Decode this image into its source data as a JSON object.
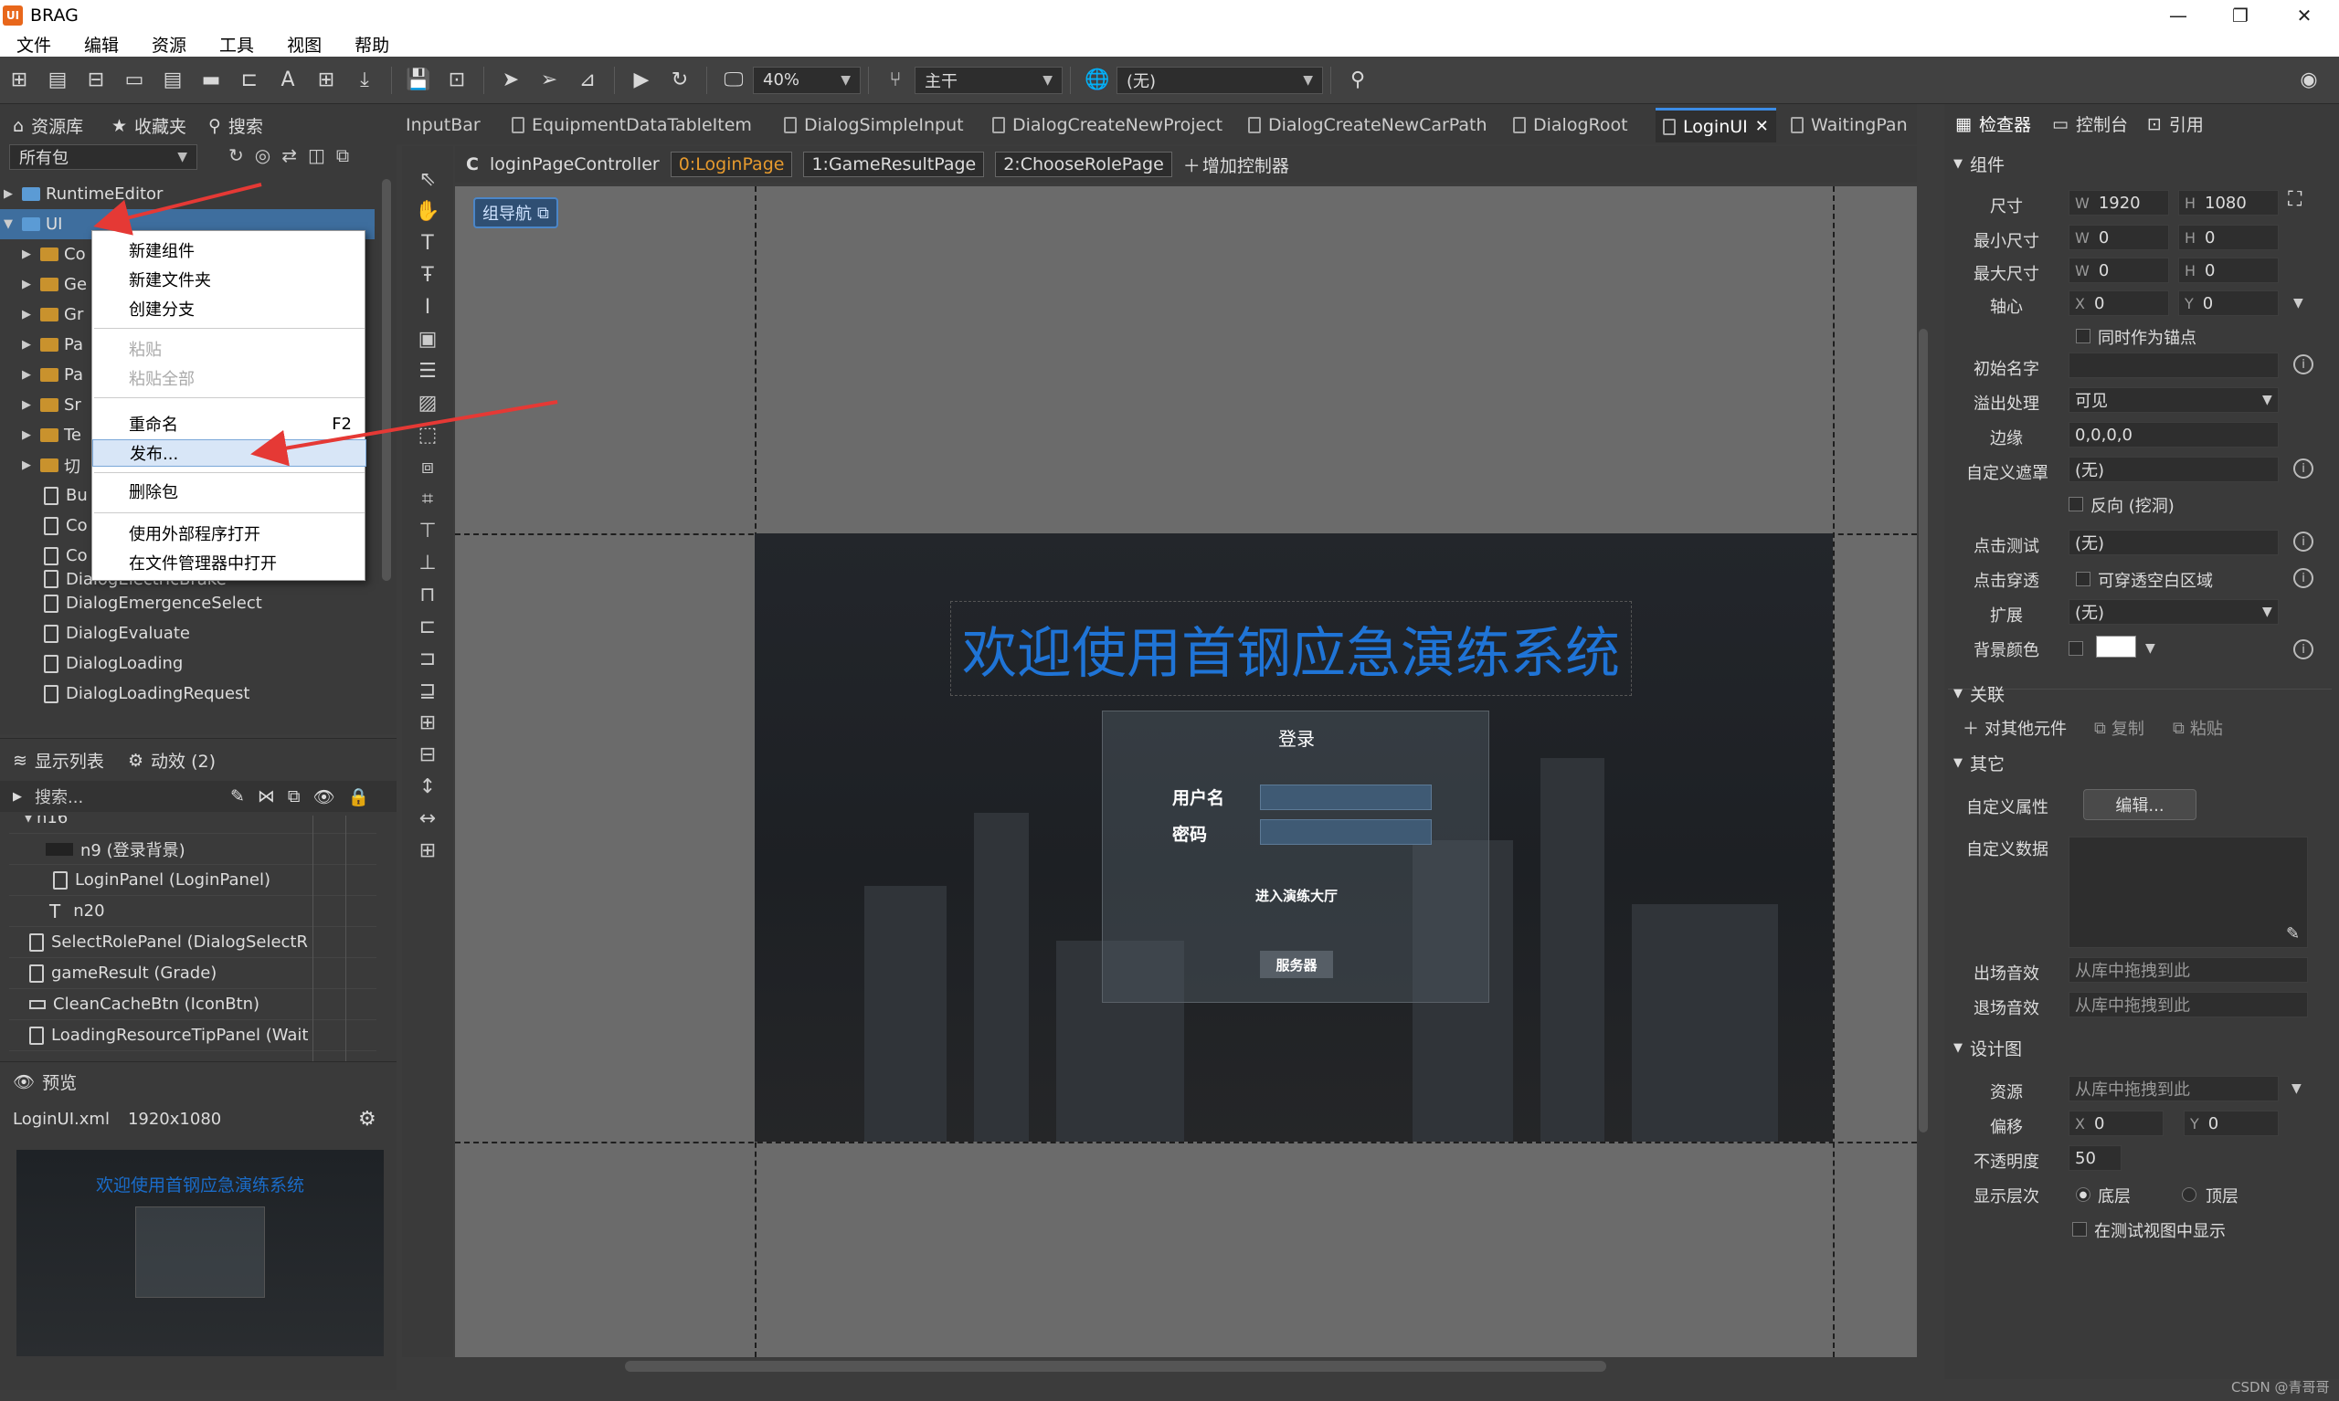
{
  "window": {
    "title": "BRAG",
    "logo": "UI"
  },
  "menu": [
    "文件",
    "编辑",
    "资源",
    "工具",
    "视图",
    "帮助"
  ],
  "toolbar": {
    "zoom": "40%",
    "branch": "主干",
    "language": "(无)"
  },
  "library": {
    "tabs": [
      "资源库",
      "收藏夹",
      "搜索"
    ],
    "package_filter": "所有包",
    "tree": [
      {
        "label": "RuntimeEditor",
        "type": "package"
      },
      {
        "label": "UI",
        "type": "package",
        "selected": true
      },
      {
        "label": "Co",
        "type": "folder"
      },
      {
        "label": "Ge",
        "type": "folder"
      },
      {
        "label": "Gr",
        "type": "folder"
      },
      {
        "label": "Pa",
        "type": "folder"
      },
      {
        "label": "Pa",
        "type": "folder"
      },
      {
        "label": "Sr",
        "type": "folder"
      },
      {
        "label": "Te",
        "type": "folder"
      },
      {
        "label": "切",
        "type": "folder"
      },
      {
        "label": "Bu",
        "type": "file"
      },
      {
        "label": "Co",
        "type": "file"
      },
      {
        "label": "Co",
        "type": "file"
      },
      {
        "label": "DialogElectricBrake",
        "type": "file"
      },
      {
        "label": "DialogEmergenceSelect",
        "type": "file"
      },
      {
        "label": "DialogEvaluate",
        "type": "file"
      },
      {
        "label": "DialogLoading",
        "type": "file"
      },
      {
        "label": "DialogLoadingRequest",
        "type": "file"
      }
    ]
  },
  "context_menu": {
    "items": [
      {
        "label": "新建组件"
      },
      {
        "label": "新建文件夹"
      },
      {
        "label": "创建分支"
      },
      {
        "label": "粘贴",
        "disabled": true
      },
      {
        "label": "粘贴全部",
        "disabled": true
      },
      {
        "label": "重命名",
        "shortcut": "F2"
      },
      {
        "label": "发布...",
        "highlighted": true
      },
      {
        "label": "删除包"
      },
      {
        "label": "使用外部程序打开"
      },
      {
        "label": "在文件管理器中打开"
      }
    ]
  },
  "hierarchy": {
    "tabs": [
      "显示列表",
      "动效 (2)"
    ],
    "search_placeholder": "搜索...",
    "rows": [
      "n16",
      "n9 (登录背景)",
      "LoginPanel (LoginPanel)",
      "n20",
      "SelectRolePanel (DialogSelectR",
      "gameResult (Grade)",
      "CleanCacheBtn (IconBtn)",
      "LoadingResourceTipPanel (Wait"
    ]
  },
  "preview": {
    "label": "预览",
    "file": "LoginUI.xml",
    "size": "1920x1080",
    "title": "欢迎使用首钢应急演练系统"
  },
  "doc_tabs": [
    "InputBar",
    "EquipmentDataTableItem",
    "DialogSimpleInput",
    "DialogCreateNewProject",
    "DialogCreateNewCarPath",
    "DialogRoot",
    "LoginUI",
    "WaitingPan"
  ],
  "active_doc": "LoginUI",
  "controller_bar": {
    "prefix": "C",
    "name": "loginPageController",
    "pages": [
      "0:LoginPage",
      "1:GameResultPage",
      "2:ChooseRolePage"
    ],
    "add": "增加控制器"
  },
  "canvas": {
    "nav_tag": "组导航",
    "headline": "欢迎使用首钢应急演练系统",
    "login_title": "登录",
    "username_label": "用户名",
    "password_label": "密码",
    "enter_button": "进入演练大厅",
    "server_button": "服务器"
  },
  "inspector": {
    "tabs": [
      "检查器",
      "控制台",
      "引用"
    ],
    "component_section": "组件",
    "size_label": "尺寸",
    "size_w": "1920",
    "size_h": "1080",
    "min_label": "最小尺寸",
    "min_w": "0",
    "min_h": "0",
    "max_label": "最大尺寸",
    "max_w": "0",
    "max_h": "0",
    "pivot_label": "轴心",
    "pivot_x": "0",
    "pivot_y": "0",
    "anchor_label": "同时作为锚点",
    "init_name_label": "初始名字",
    "init_name": "",
    "overflow_label": "溢出处理",
    "overflow": "可见",
    "margin_label": "边缘",
    "margin": "0,0,0,0",
    "mask_label": "自定义遮罩",
    "mask": "(无)",
    "reverse_label": "反向 (挖洞)",
    "hittest_label": "点击测试",
    "hittest": "(无)",
    "passthrough_label": "点击穿透",
    "passthrough_opt": "可穿透空白区域",
    "extend_label": "扩展",
    "extend": "(无)",
    "bgcolor_label": "背景颜色",
    "bgcolor": "#ffffff",
    "relation_section": "关联",
    "add_relation": "对其他元件",
    "copy": "复制",
    "paste": "粘贴",
    "other_section": "其它",
    "custom_prop_label": "自定义属性",
    "edit_button": "编辑...",
    "custom_data_label": "自定义数据",
    "in_sound_label": "出场音效",
    "in_sound": "从库中拖拽到此",
    "out_sound_label": "退场音效",
    "out_sound": "从库中拖拽到此",
    "design_section": "设计图",
    "res_label": "资源",
    "res": "从库中拖拽到此",
    "offset_label": "偏移",
    "offset_x": "0",
    "offset_y": "0",
    "opacity_label": "不透明度",
    "opacity": "50",
    "layer_label": "显示层次",
    "layer_bottom": "底层",
    "layer_top": "顶层",
    "show_in_test": "在测试视图中显示"
  },
  "watermark": "CSDN @青哥哥",
  "colors": {
    "accent": "#1a6cc9",
    "highlight_tab": "#e69a2e",
    "arrow": "#e53935"
  }
}
